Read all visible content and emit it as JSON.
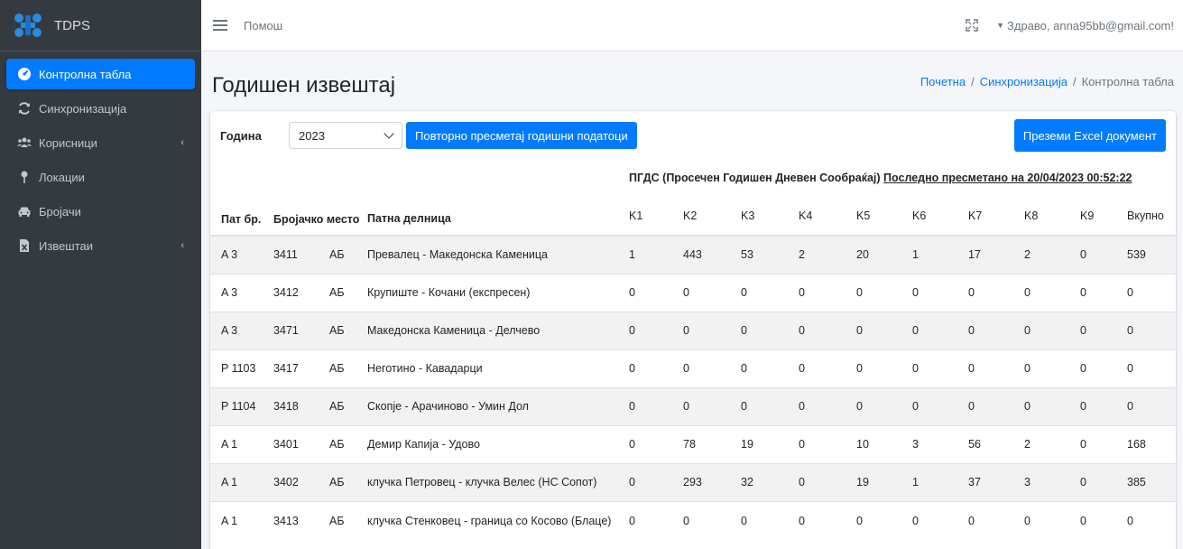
{
  "brand": {
    "name": "TDPS"
  },
  "sidebar": {
    "items": [
      {
        "label": "Контролна табла",
        "icon": "dashboard-icon",
        "active": true
      },
      {
        "label": "Синхронизација",
        "icon": "sync-icon"
      },
      {
        "label": "Корисници",
        "icon": "users-icon",
        "has_submenu": true
      },
      {
        "label": "Локации",
        "icon": "map-pin-icon"
      },
      {
        "label": "Бројачи",
        "icon": "car-icon"
      },
      {
        "label": "Извештаи",
        "icon": "report-icon",
        "has_submenu": true
      }
    ],
    "submenu_arrow": "‹"
  },
  "topbar": {
    "help": "Помош",
    "user": "Здраво, anna95bb@gmail.com!"
  },
  "header": {
    "title": "Годишен извештај",
    "breadcrumb": [
      "Почетна",
      "Синхронизација",
      "Контролна табла"
    ],
    "breadcrumb_sep": "/"
  },
  "toolbar": {
    "year_label": "Година",
    "year_value": "2023",
    "recalc_label": "Повторно пресметај годишни податоци",
    "excel_label": "Преземи Excel документ"
  },
  "table": {
    "pgds_title": "ПГДС (Просечен Годишен Дневен Сообраќај)",
    "pgds_recalc": "Последно пресметано на 20/04/2023 00:52:22",
    "headers": {
      "pat": "Пат бр.",
      "mesto": "Бројачко место",
      "delnica": "Патна делница",
      "k": [
        "K1",
        "K2",
        "K3",
        "K4",
        "K5",
        "K6",
        "K7",
        "K8",
        "K9"
      ],
      "total": "Вкупно"
    },
    "rows": [
      {
        "pat": "A 3",
        "mesto": "3411",
        "type": "АБ",
        "delnica": "Превалец - Македонска Каменица",
        "k": [
          "1",
          "443",
          "53",
          "2",
          "20",
          "1",
          "17",
          "2",
          "0"
        ],
        "total": "539"
      },
      {
        "pat": "A 3",
        "mesto": "3412",
        "type": "АБ",
        "delnica": "Крупиште - Кочани (експресен)",
        "k": [
          "0",
          "0",
          "0",
          "0",
          "0",
          "0",
          "0",
          "0",
          "0"
        ],
        "total": "0"
      },
      {
        "pat": "A 3",
        "mesto": "3471",
        "type": "АБ",
        "delnica": "Македонска Каменица - Делчево",
        "k": [
          "0",
          "0",
          "0",
          "0",
          "0",
          "0",
          "0",
          "0",
          "0"
        ],
        "total": "0"
      },
      {
        "pat": "P 1103",
        "mesto": "3417",
        "type": "АБ",
        "delnica": "Неготино - Кавадарци",
        "k": [
          "0",
          "0",
          "0",
          "0",
          "0",
          "0",
          "0",
          "0",
          "0"
        ],
        "total": "0"
      },
      {
        "pat": "P 1104",
        "mesto": "3418",
        "type": "АБ",
        "delnica": "Скопје - Арачиново - Умин Дол",
        "k": [
          "0",
          "0",
          "0",
          "0",
          "0",
          "0",
          "0",
          "0",
          "0"
        ],
        "total": "0"
      },
      {
        "pat": "A 1",
        "mesto": "3401",
        "type": "АБ",
        "delnica": "Демир Капија - Удово",
        "k": [
          "0",
          "78",
          "19",
          "0",
          "10",
          "3",
          "56",
          "2",
          "0"
        ],
        "total": "168"
      },
      {
        "pat": "A 1",
        "mesto": "3402",
        "type": "АБ",
        "delnica": "клучка Петровец - клучка Велес (НС Сопот)",
        "k": [
          "0",
          "293",
          "32",
          "0",
          "19",
          "1",
          "37",
          "3",
          "0"
        ],
        "total": "385"
      },
      {
        "pat": "A 1",
        "mesto": "3413",
        "type": "АБ",
        "delnica": "клучка Стенковец - граница со Косово (Блаце)",
        "k": [
          "0",
          "0",
          "0",
          "0",
          "0",
          "0",
          "0",
          "0",
          "0"
        ],
        "total": "0"
      }
    ]
  }
}
